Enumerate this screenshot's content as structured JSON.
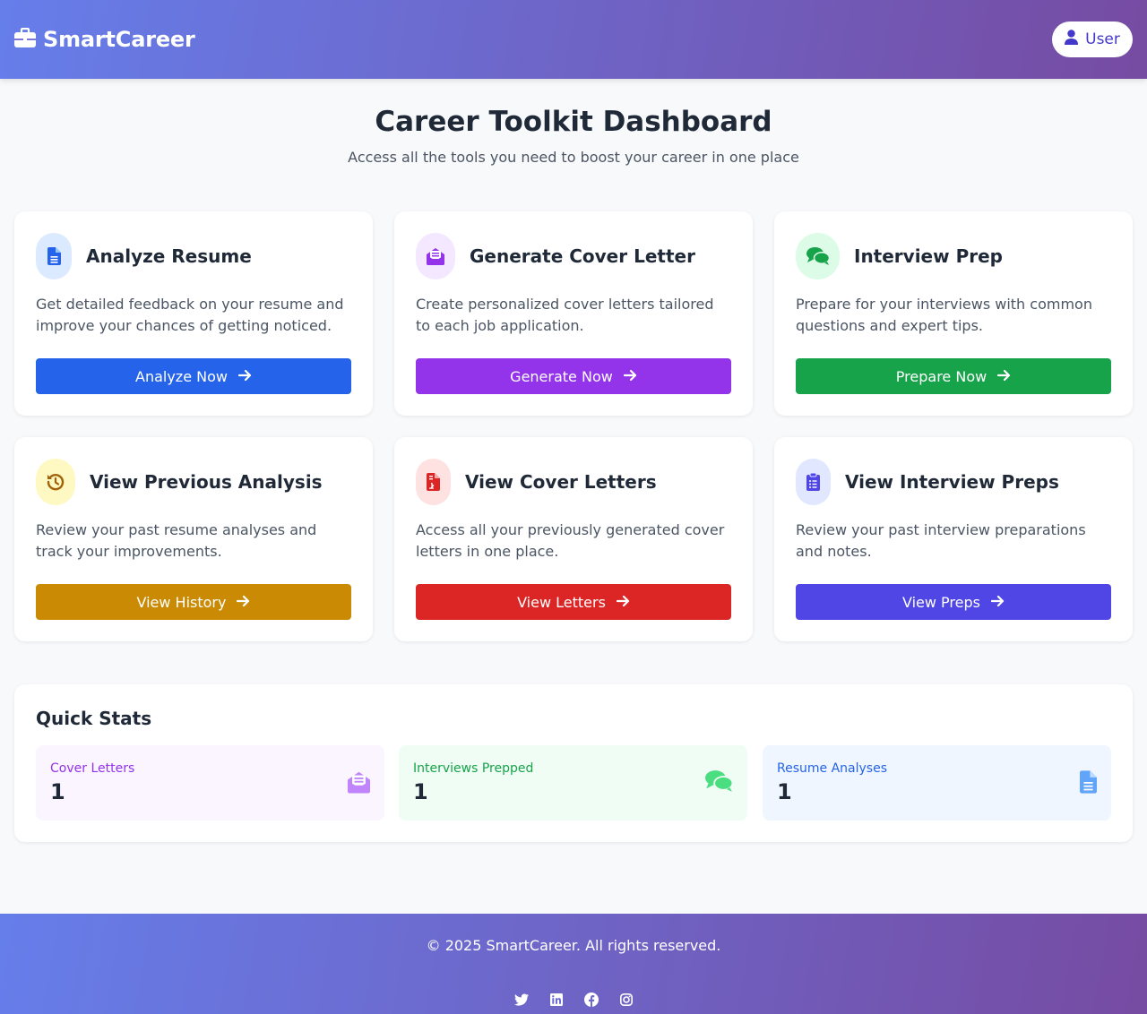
{
  "header": {
    "brand": "SmartCareer",
    "user_label": "User"
  },
  "page": {
    "title": "Career Toolkit Dashboard",
    "subtitle": "Access all the tools you need to boost your career in one place"
  },
  "cards": [
    {
      "title": "Analyze Resume",
      "desc": "Get detailed feedback on your resume and improve your chances of getting noticed.",
      "button": "Analyze Now",
      "icon": "file-text-icon",
      "color": "#2563eb",
      "bg": "#dbeafe"
    },
    {
      "title": "Generate Cover Letter",
      "desc": "Create personalized cover letters tailored to each job application.",
      "button": "Generate Now",
      "icon": "envelope-open-icon",
      "color": "#9333ea",
      "bg": "#f3e8ff"
    },
    {
      "title": "Interview Prep",
      "desc": "Prepare for your interviews with common questions and expert tips.",
      "button": "Prepare Now",
      "icon": "comments-icon",
      "color": "#16a34a",
      "bg": "#dcfce7"
    },
    {
      "title": "View Previous Analysis",
      "desc": "Review your past resume analyses and track your improvements.",
      "button": "View History",
      "icon": "history-icon",
      "color": "#ca8a04",
      "bg": "#fef9c3"
    },
    {
      "title": "View Cover Letters",
      "desc": "Access all your previously generated cover letters in one place.",
      "button": "View Letters",
      "icon": "file-contract-icon",
      "color": "#dc2626",
      "bg": "#fee2e2"
    },
    {
      "title": "View Interview Preps",
      "desc": "Review your past interview preparations and notes.",
      "button": "View Preps",
      "icon": "clipboard-list-icon",
      "color": "#4f46e5",
      "bg": "#e0e7ff"
    }
  ],
  "stats": {
    "title": "Quick Stats",
    "items": [
      {
        "label": "Cover Letters",
        "value": "1",
        "icon": "envelope-open-icon",
        "color": "#9333ea",
        "iconColor": "#c084fc",
        "bg": "#faf5ff"
      },
      {
        "label": "Interviews Prepped",
        "value": "1",
        "icon": "comments-icon",
        "color": "#16a34a",
        "iconColor": "#4ade80",
        "bg": "#f0fdf4"
      },
      {
        "label": "Resume Analyses",
        "value": "1",
        "icon": "file-text-icon",
        "color": "#2563eb",
        "iconColor": "#60a5fa",
        "bg": "#eff6ff"
      }
    ]
  },
  "footer": {
    "copyright": "© 2025 SmartCareer. All rights reserved.",
    "socials": [
      "twitter-icon",
      "linkedin-icon",
      "facebook-icon",
      "instagram-icon"
    ]
  }
}
